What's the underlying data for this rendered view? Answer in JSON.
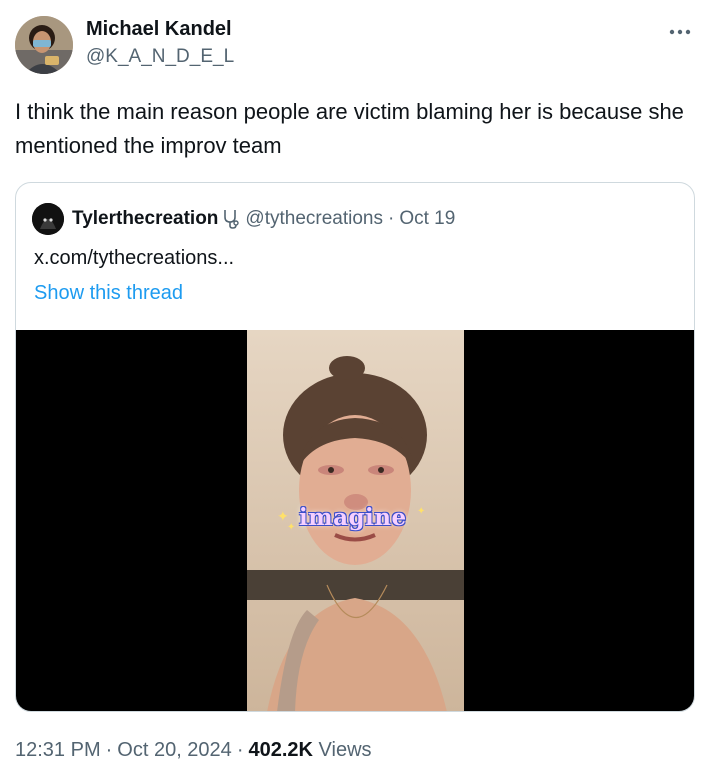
{
  "author": {
    "name": "Michael Kandel",
    "handle": "@K_A_N_D_E_L"
  },
  "tweet": {
    "text": "I think the main reason people are victim blaming her is because she mentioned the improv team"
  },
  "quoted": {
    "name": "Tylerthecreation",
    "name_emoji": "stethoscope-icon",
    "handle": "@tythecreations",
    "separator": "·",
    "date": "Oct 19",
    "text": "x.com/tythecreations...",
    "thread_link": "Show this thread",
    "media_sticker": "imagine"
  },
  "meta": {
    "time": "12:31 PM",
    "separator": "·",
    "date": "Oct 20, 2024",
    "views_count": "402.2K",
    "views_label": "Views"
  },
  "icons": {
    "more": "more-horizontal-icon"
  },
  "colors": {
    "link": "#1d9bf0",
    "secondary_text": "#536471",
    "border": "#cfd9de"
  }
}
